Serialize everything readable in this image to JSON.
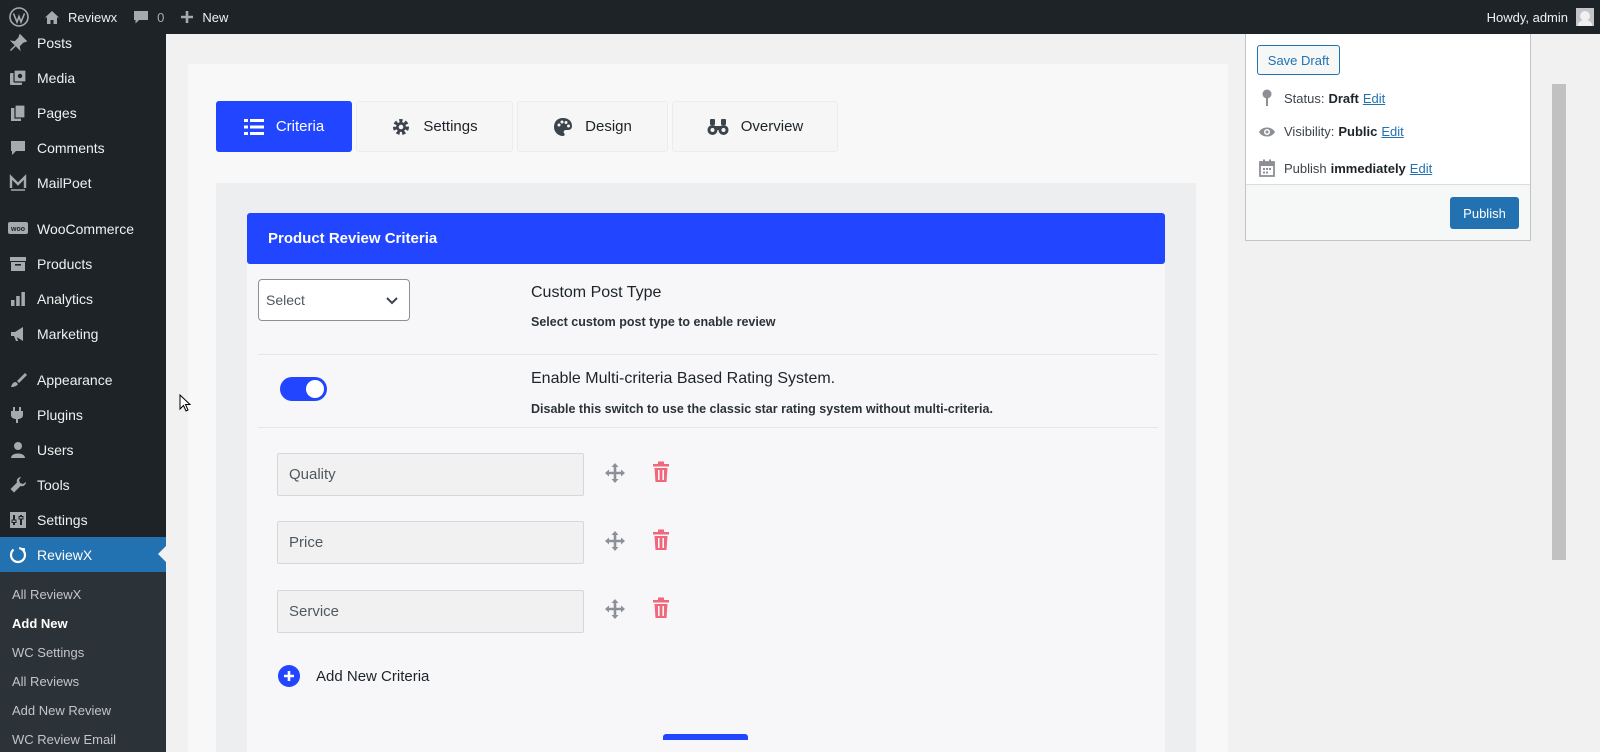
{
  "adminbar": {
    "site_name": "Reviewx",
    "comments_count": "0",
    "new_label": "New",
    "howdy": "Howdy, admin"
  },
  "sidebar": {
    "items": [
      {
        "label": "Posts",
        "icon": "pin-icon"
      },
      {
        "label": "Media",
        "icon": "media-icon"
      },
      {
        "label": "Pages",
        "icon": "pages-icon"
      },
      {
        "label": "Comments",
        "icon": "comment-icon"
      },
      {
        "label": "MailPoet",
        "icon": "mailpoet-icon"
      },
      {
        "label": "WooCommerce",
        "icon": "woo-icon"
      },
      {
        "label": "Products",
        "icon": "archive-icon"
      },
      {
        "label": "Analytics",
        "icon": "chart-icon"
      },
      {
        "label": "Marketing",
        "icon": "megaphone-icon"
      },
      {
        "label": "Appearance",
        "icon": "brush-icon"
      },
      {
        "label": "Plugins",
        "icon": "plug-icon"
      },
      {
        "label": "Users",
        "icon": "user-icon"
      },
      {
        "label": "Tools",
        "icon": "wrench-icon"
      },
      {
        "label": "Settings",
        "icon": "sliders-icon"
      },
      {
        "label": "ReviewX",
        "icon": "reviewx-icon"
      }
    ],
    "submenu": [
      "All ReviewX",
      "Add New",
      "WC Settings",
      "All Reviews",
      "Add New Review",
      "WC Review Email"
    ]
  },
  "tabs": [
    "Criteria",
    "Settings",
    "Design",
    "Overview"
  ],
  "card": {
    "header": "Product Review Criteria",
    "select_value": "Select",
    "cpt_title": "Custom Post Type",
    "cpt_desc": "Select custom post type to enable review",
    "multi_title": "Enable Multi-criteria Based Rating System.",
    "multi_desc": "Disable this switch to use the classic star rating system without multi-criteria.",
    "multi_enabled": true,
    "criteria": [
      "Quality",
      "Price",
      "Service"
    ],
    "add_label": "Add New Criteria"
  },
  "publish": {
    "save_draft": "Save Draft",
    "status_label": "Status:",
    "status_value": "Draft",
    "visibility_label": "Visibility:",
    "visibility_value": "Public",
    "publish_label": "Publish",
    "publish_value": "immediately",
    "edit": "Edit",
    "publish_button": "Publish"
  },
  "colors": {
    "accent": "#2245ff",
    "wp_blue": "#2271b1",
    "admin_dark": "#1d2327",
    "delete": "#f0667b"
  }
}
